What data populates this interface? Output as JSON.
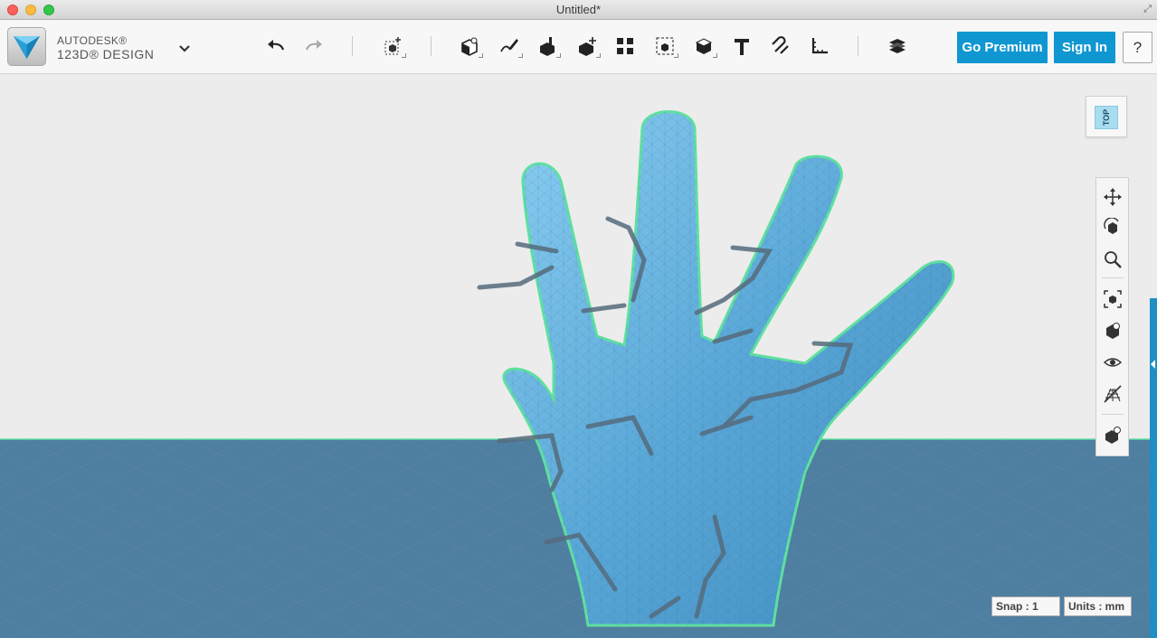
{
  "window": {
    "title": "Untitled*"
  },
  "app": {
    "brand_line1": "AUTODESK®",
    "brand_line2": "123D® DESIGN"
  },
  "toolbar": {
    "tools": [
      "undo",
      "redo",
      "transform",
      "primitives",
      "sketch",
      "construct",
      "modify",
      "pattern",
      "grouping",
      "combine",
      "text",
      "snap",
      "measure",
      "material"
    ],
    "go_premium_label": "Go Premium",
    "sign_in_label": "Sign In",
    "help_label": "?"
  },
  "viewcube": {
    "face_label": "TOP"
  },
  "navbar": {
    "items": [
      "pan",
      "orbit",
      "zoom",
      "fit",
      "views",
      "visibility",
      "grid-toggle",
      "material-settings"
    ]
  },
  "status": {
    "snap": "Snap : 1",
    "units": "Units : mm"
  },
  "colors": {
    "accent": "#1097d1",
    "model": "#5aa8d8",
    "ground": "#4f7fa0",
    "background": "#ececec",
    "outline": "#5fe0a0"
  }
}
